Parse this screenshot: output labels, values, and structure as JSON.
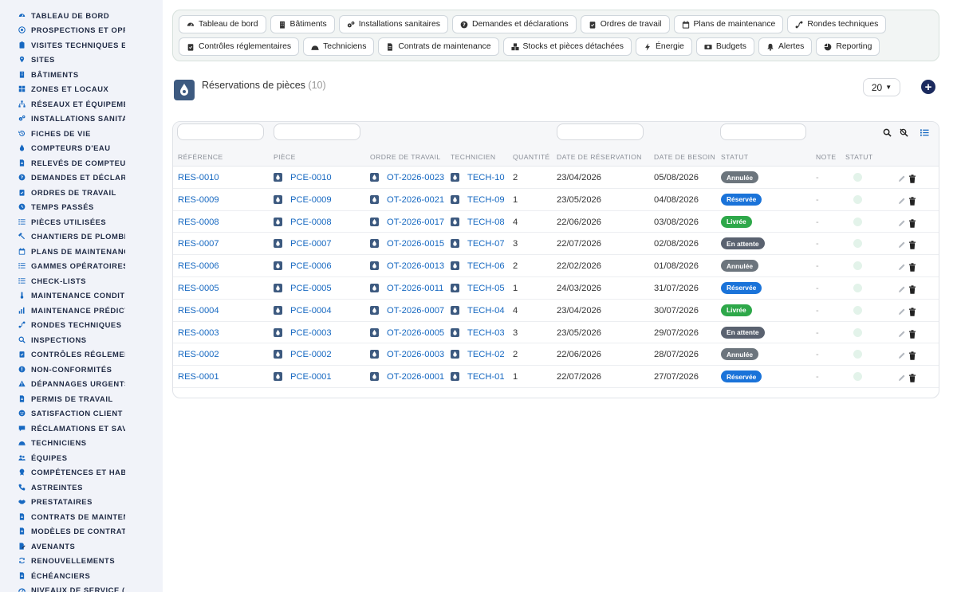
{
  "sidebar": {
    "items": [
      {
        "label": "TABLEAU DE BORD",
        "icon": "dashboard-icon"
      },
      {
        "label": "PROSPECTIONS ET OPPORTUNITÉS",
        "icon": "target-icon"
      },
      {
        "label": "VISITES TECHNIQUES ET AUDITS",
        "icon": "clipboard-icon"
      },
      {
        "label": "SITES",
        "icon": "map-pin-icon"
      },
      {
        "label": "BÂTIMENTS",
        "icon": "building-icon"
      },
      {
        "label": "ZONES ET LOCAUX",
        "icon": "grid-icon"
      },
      {
        "label": "RÉSEAUX ET ÉQUIPEMENTS",
        "icon": "network-icon"
      },
      {
        "label": "INSTALLATIONS SANITAIRES",
        "icon": "gears-icon"
      },
      {
        "label": "FICHES DE VIE",
        "icon": "history-icon"
      },
      {
        "label": "COMPTEURS D'EAU",
        "icon": "droplet-icon"
      },
      {
        "label": "RELEVÉS DE COMPTEURS",
        "icon": "document-icon"
      },
      {
        "label": "DEMANDES ET DÉCLARATIONS",
        "icon": "question-icon"
      },
      {
        "label": "ORDRES DE TRAVAIL",
        "icon": "clipboard-check-icon"
      },
      {
        "label": "TEMPS PASSÉS",
        "icon": "clock-icon"
      },
      {
        "label": "PIÈCES UTILISÉES",
        "icon": "list-icon"
      },
      {
        "label": "CHANTIERS DE PLOMBERIE",
        "icon": "hammer-icon"
      },
      {
        "label": "PLANS DE MAINTENANCE",
        "icon": "calendar-icon"
      },
      {
        "label": "GAMMES OPÉRATOIRES",
        "icon": "list-icon"
      },
      {
        "label": "CHECK-LISTS",
        "icon": "list-icon"
      },
      {
        "label": "MAINTENANCE CONDITIONNELLE",
        "icon": "thermometer-icon"
      },
      {
        "label": "MAINTENANCE PRÉDICTIVE",
        "icon": "chart-icon"
      },
      {
        "label": "RONDES TECHNIQUES",
        "icon": "route-icon"
      },
      {
        "label": "INSPECTIONS",
        "icon": "search-icon"
      },
      {
        "label": "CONTRÔLES RÉGLEMENTAIRES",
        "icon": "clipboard-check-icon"
      },
      {
        "label": "NON-CONFORMITÉS",
        "icon": "alert-circle-icon"
      },
      {
        "label": "DÉPANNAGES URGENTS",
        "icon": "warning-icon"
      },
      {
        "label": "PERMIS DE TRAVAIL",
        "icon": "document-icon"
      },
      {
        "label": "SATISFACTION CLIENT",
        "icon": "smile-icon"
      },
      {
        "label": "RÉCLAMATIONS ET SAV",
        "icon": "chat-icon"
      },
      {
        "label": "TECHNICIENS",
        "icon": "helmet-icon"
      },
      {
        "label": "ÉQUIPES",
        "icon": "users-icon"
      },
      {
        "label": "COMPÉTENCES ET HABILITATIONS",
        "icon": "certificate-icon"
      },
      {
        "label": "ASTREINTES",
        "icon": "phone-icon"
      },
      {
        "label": "PRESTATAIRES",
        "icon": "handshake-icon"
      },
      {
        "label": "CONTRATS DE MAINTENANCE",
        "icon": "document-icon"
      },
      {
        "label": "MODÈLES DE CONTRATS",
        "icon": "document-icon"
      },
      {
        "label": "AVENANTS",
        "icon": "edit-document-icon"
      },
      {
        "label": "RENOUVELLEMENTS",
        "icon": "refresh-icon"
      },
      {
        "label": "ÉCHÉANCIERS",
        "icon": "document-icon"
      },
      {
        "label": "NIVEAUX DE SERVICE (SLA)",
        "icon": "gauge-icon"
      }
    ]
  },
  "topnav": {
    "row1": [
      {
        "label": "Tableau de bord",
        "icon": "dashboard-icon"
      },
      {
        "label": "Bâtiments",
        "icon": "building-icon"
      },
      {
        "label": "Installations sanitaires",
        "icon": "gears-icon"
      },
      {
        "label": "Demandes et déclarations",
        "icon": "question-icon"
      },
      {
        "label": "Ordres de travail",
        "icon": "clipboard-check-icon"
      },
      {
        "label": "Plans de maintenance",
        "icon": "calendar-icon"
      },
      {
        "label": "Rondes techniques",
        "icon": "route-icon"
      }
    ],
    "row2": [
      {
        "label": "Contrôles réglementaires",
        "icon": "clipboard-check-icon"
      },
      {
        "label": "Techniciens",
        "icon": "helmet-icon"
      },
      {
        "label": "Contrats de maintenance",
        "icon": "document-icon"
      },
      {
        "label": "Stocks et pièces détachées",
        "icon": "boxes-icon"
      },
      {
        "label": "Énergie",
        "icon": "bolt-icon"
      },
      {
        "label": "Budgets",
        "icon": "money-icon"
      },
      {
        "label": "Alertes",
        "icon": "bell-icon"
      },
      {
        "label": "Reporting",
        "icon": "pie-icon"
      }
    ]
  },
  "page": {
    "title": "Réservations de pièces",
    "count": "(10)",
    "page_size": "20",
    "add_label": "+"
  },
  "table": {
    "headers": {
      "reference": "RÉFÉRENCE",
      "piece": "PIÈCE",
      "ordre": "ORDRE DE TRAVAIL",
      "technicien": "TECHNICIEN",
      "quantite": "QUANTITÉ",
      "date_reservation": "DATE DE RÉSERVATION",
      "date_besoin": "DATE DE BESOIN",
      "statut": "STATUT",
      "note": "NOTE",
      "statut2": "STATUT"
    },
    "rows": [
      {
        "ref": "RES-0010",
        "piece": "PCE-0010",
        "ot": "OT-2026-0023",
        "tech": "TECH-10",
        "qty": "2",
        "date_res": "23/04/2026",
        "date_besoin": "05/08/2026",
        "statut": "Annulée",
        "note": "-"
      },
      {
        "ref": "RES-0009",
        "piece": "PCE-0009",
        "ot": "OT-2026-0021",
        "tech": "TECH-09",
        "qty": "1",
        "date_res": "23/05/2026",
        "date_besoin": "04/08/2026",
        "statut": "Réservée",
        "note": "-"
      },
      {
        "ref": "RES-0008",
        "piece": "PCE-0008",
        "ot": "OT-2026-0017",
        "tech": "TECH-08",
        "qty": "4",
        "date_res": "22/06/2026",
        "date_besoin": "03/08/2026",
        "statut": "Livrée",
        "note": "-"
      },
      {
        "ref": "RES-0007",
        "piece": "PCE-0007",
        "ot": "OT-2026-0015",
        "tech": "TECH-07",
        "qty": "3",
        "date_res": "22/07/2026",
        "date_besoin": "02/08/2026",
        "statut": "En attente",
        "note": "-"
      },
      {
        "ref": "RES-0006",
        "piece": "PCE-0006",
        "ot": "OT-2026-0013",
        "tech": "TECH-06",
        "qty": "2",
        "date_res": "22/02/2026",
        "date_besoin": "01/08/2026",
        "statut": "Annulée",
        "note": "-"
      },
      {
        "ref": "RES-0005",
        "piece": "PCE-0005",
        "ot": "OT-2026-0011",
        "tech": "TECH-05",
        "qty": "1",
        "date_res": "24/03/2026",
        "date_besoin": "31/07/2026",
        "statut": "Réservée",
        "note": "-"
      },
      {
        "ref": "RES-0004",
        "piece": "PCE-0004",
        "ot": "OT-2026-0007",
        "tech": "TECH-04",
        "qty": "4",
        "date_res": "23/04/2026",
        "date_besoin": "30/07/2026",
        "statut": "Livrée",
        "note": "-"
      },
      {
        "ref": "RES-0003",
        "piece": "PCE-0003",
        "ot": "OT-2026-0005",
        "tech": "TECH-03",
        "qty": "3",
        "date_res": "23/05/2026",
        "date_besoin": "29/07/2026",
        "statut": "En attente",
        "note": "-"
      },
      {
        "ref": "RES-0002",
        "piece": "PCE-0002",
        "ot": "OT-2026-0003",
        "tech": "TECH-02",
        "qty": "2",
        "date_res": "22/06/2026",
        "date_besoin": "28/07/2026",
        "statut": "Annulée",
        "note": "-"
      },
      {
        "ref": "RES-0001",
        "piece": "PCE-0001",
        "ot": "OT-2026-0001",
        "tech": "TECH-01",
        "qty": "1",
        "date_res": "22/07/2026",
        "date_besoin": "27/07/2026",
        "statut": "Réservée",
        "note": "-"
      }
    ]
  },
  "colors": {
    "sidebar_icon": "#1668c1",
    "link": "#1668c1",
    "status": {
      "Annulée": "#6c757d",
      "Réservée": "#1a73d9",
      "Livrée": "#2ea84a",
      "En attente": "#5a6270"
    },
    "add_button": "#1b2a5e"
  }
}
